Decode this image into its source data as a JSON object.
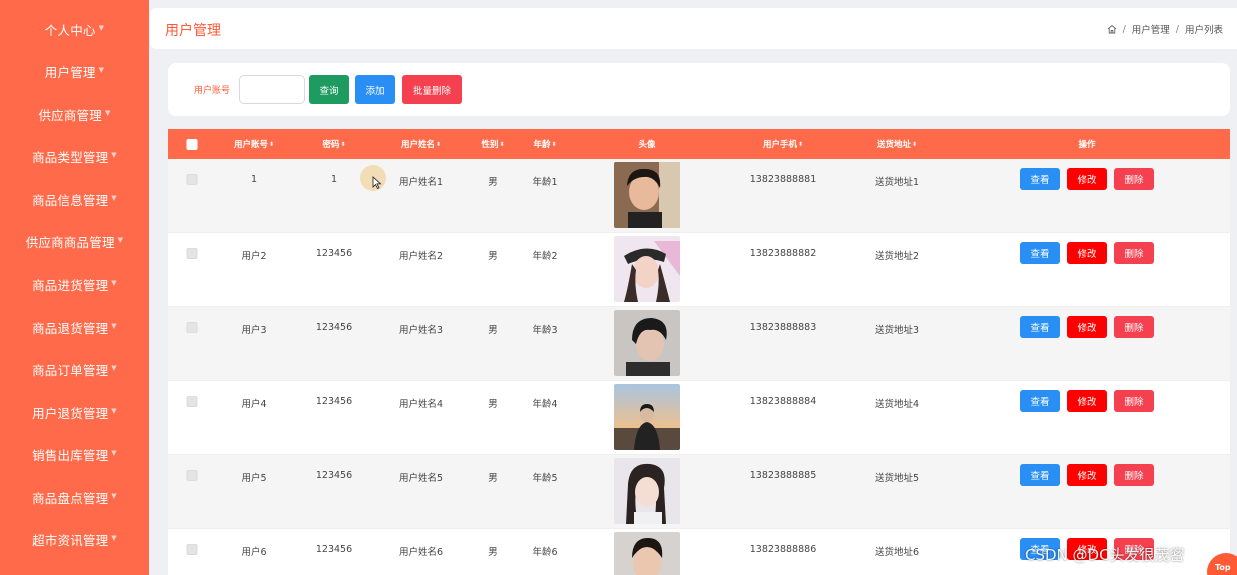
{
  "sidebar": {
    "items": [
      {
        "label": "个人中心"
      },
      {
        "label": "用户管理"
      },
      {
        "label": "供应商管理"
      },
      {
        "label": "商品类型管理"
      },
      {
        "label": "商品信息管理"
      },
      {
        "label": "供应商商品管理"
      },
      {
        "label": "商品进货管理"
      },
      {
        "label": "商品退货管理"
      },
      {
        "label": "商品订单管理"
      },
      {
        "label": "用户退货管理"
      },
      {
        "label": "销售出库管理"
      },
      {
        "label": "商品盘点管理"
      },
      {
        "label": "超市资讯管理"
      }
    ]
  },
  "header": {
    "title": "用户管理",
    "breadcrumb": [
      "用户管理",
      "用户列表"
    ]
  },
  "search": {
    "label": "用户账号",
    "value": "",
    "placeholder": "",
    "query_label": "查询",
    "add_label": "添加",
    "batch_delete_label": "批量删除"
  },
  "table": {
    "columns": [
      "用户账号",
      "密码",
      "用户姓名",
      "性别",
      "年龄",
      "头像",
      "用户手机",
      "送货地址",
      "操作"
    ],
    "rows": [
      {
        "account": "1",
        "password": "1",
        "name": "用户姓名1",
        "gender": "男",
        "age": "年龄1",
        "phone": "13823888881",
        "address": "送货地址1"
      },
      {
        "account": "用户2",
        "password": "123456",
        "name": "用户姓名2",
        "gender": "男",
        "age": "年龄2",
        "phone": "13823888882",
        "address": "送货地址2"
      },
      {
        "account": "用户3",
        "password": "123456",
        "name": "用户姓名3",
        "gender": "男",
        "age": "年龄3",
        "phone": "13823888883",
        "address": "送货地址3"
      },
      {
        "account": "用户4",
        "password": "123456",
        "name": "用户姓名4",
        "gender": "男",
        "age": "年龄4",
        "phone": "13823888884",
        "address": "送货地址4"
      },
      {
        "account": "用户5",
        "password": "123456",
        "name": "用户姓名5",
        "gender": "男",
        "age": "年龄5",
        "phone": "13823888885",
        "address": "送货地址5"
      },
      {
        "account": "用户6",
        "password": "123456",
        "name": "用户姓名6",
        "gender": "男",
        "age": "年龄6",
        "phone": "13823888886",
        "address": "送货地址6"
      }
    ],
    "actions": {
      "view": "查看",
      "edit": "修改",
      "delete": "删除"
    }
  },
  "watermark": "CSDN @DC头发很茂密",
  "back_to_top": "Top",
  "colors": {
    "accent": "#ff6b4a",
    "title": "#ff5a36",
    "query": "#1e9b5e",
    "add": "#2a8ff5",
    "danger": "#f5414f",
    "edit": "#ff0000"
  }
}
